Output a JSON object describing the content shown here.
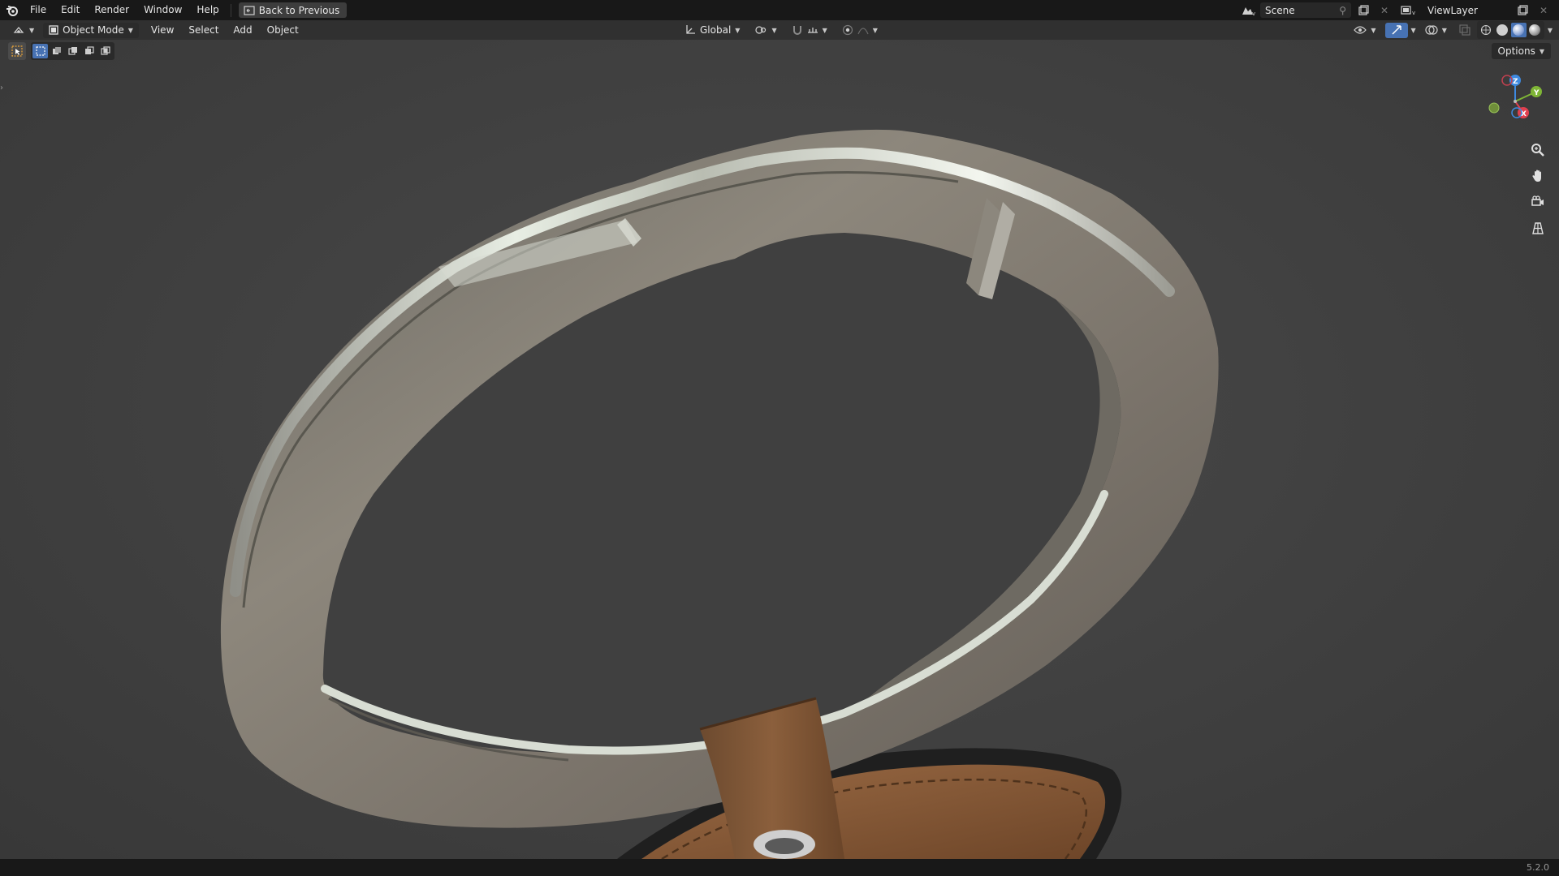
{
  "topbar": {
    "menu": [
      "File",
      "Edit",
      "Render",
      "Window",
      "Help"
    ],
    "back_button": "Back to Previous",
    "scene_name": "Scene",
    "view_layer_name": "ViewLayer"
  },
  "header": {
    "mode": "Object Mode",
    "menus": [
      "View",
      "Select",
      "Add",
      "Object"
    ],
    "transform_orientation": "Global"
  },
  "toolbar": {
    "options_label": "Options"
  },
  "gizmo": {
    "z_label": "Z",
    "y_label": "Y",
    "x_label": "X"
  },
  "statusbar": {
    "version": "5.2.0"
  },
  "colors": {
    "accent": "#4772b3",
    "axis_x": "#e0404f",
    "axis_y": "#7fb536",
    "axis_z": "#3e8ae0",
    "leather": "#8a5a36"
  },
  "icons": {
    "logo": "blender-logo-icon",
    "pan": "hand-icon",
    "zoom": "magnify-icon",
    "camera": "camera-icon",
    "grid": "grid-icon"
  }
}
